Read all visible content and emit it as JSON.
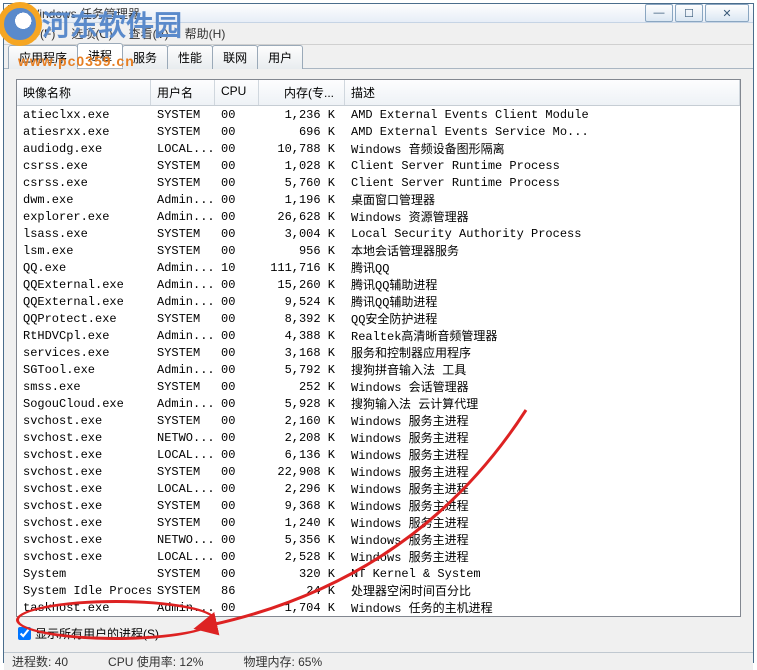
{
  "window": {
    "title": "Windows 任务管理器"
  },
  "watermark": {
    "text": "河东软件园",
    "sub": "www.pc0359.cn"
  },
  "menu": {
    "file": "文件(F)",
    "options": "选项(O)",
    "view": "查看(V)",
    "help": "帮助(H)"
  },
  "tabs": {
    "apps": "应用程序",
    "processes": "进程",
    "services": "服务",
    "performance": "性能",
    "networking": "联网",
    "users": "用户"
  },
  "columns": {
    "image": "映像名称",
    "user": "用户名",
    "cpu": "CPU",
    "mem": "内存(专...",
    "desc": "描述"
  },
  "rows": [
    {
      "img": "atieclxx.exe",
      "user": "SYSTEM",
      "cpu": "00",
      "mem": "1,236 K",
      "desc": "AMD External Events Client Module"
    },
    {
      "img": "atiesrxx.exe",
      "user": "SYSTEM",
      "cpu": "00",
      "mem": "696 K",
      "desc": "AMD External Events Service Mo..."
    },
    {
      "img": "audiodg.exe",
      "user": "LOCAL...",
      "cpu": "00",
      "mem": "10,788 K",
      "desc": "Windows 音频设备图形隔离"
    },
    {
      "img": "csrss.exe",
      "user": "SYSTEM",
      "cpu": "00",
      "mem": "1,028 K",
      "desc": "Client Server Runtime Process"
    },
    {
      "img": "csrss.exe",
      "user": "SYSTEM",
      "cpu": "00",
      "mem": "5,760 K",
      "desc": "Client Server Runtime Process"
    },
    {
      "img": "dwm.exe",
      "user": "Admin...",
      "cpu": "00",
      "mem": "1,196 K",
      "desc": "桌面窗口管理器"
    },
    {
      "img": "explorer.exe",
      "user": "Admin...",
      "cpu": "00",
      "mem": "26,628 K",
      "desc": "Windows 资源管理器"
    },
    {
      "img": "lsass.exe",
      "user": "SYSTEM",
      "cpu": "00",
      "mem": "3,004 K",
      "desc": "Local Security Authority Process"
    },
    {
      "img": "lsm.exe",
      "user": "SYSTEM",
      "cpu": "00",
      "mem": "956 K",
      "desc": "本地会话管理器服务"
    },
    {
      "img": "QQ.exe",
      "user": "Admin...",
      "cpu": "10",
      "mem": "111,716 K",
      "desc": "腾讯QQ"
    },
    {
      "img": "QQExternal.exe",
      "user": "Admin...",
      "cpu": "00",
      "mem": "15,260 K",
      "desc": "腾讯QQ辅助进程"
    },
    {
      "img": "QQExternal.exe",
      "user": "Admin...",
      "cpu": "00",
      "mem": "9,524 K",
      "desc": "腾讯QQ辅助进程"
    },
    {
      "img": "QQProtect.exe",
      "user": "SYSTEM",
      "cpu": "00",
      "mem": "8,392 K",
      "desc": "QQ安全防护进程"
    },
    {
      "img": "RtHDVCpl.exe",
      "user": "Admin...",
      "cpu": "00",
      "mem": "4,388 K",
      "desc": "Realtek高清晰音频管理器"
    },
    {
      "img": "services.exe",
      "user": "SYSTEM",
      "cpu": "00",
      "mem": "3,168 K",
      "desc": "服务和控制器应用程序"
    },
    {
      "img": "SGTool.exe",
      "user": "Admin...",
      "cpu": "00",
      "mem": "5,792 K",
      "desc": "搜狗拼音输入法 工具"
    },
    {
      "img": "smss.exe",
      "user": "SYSTEM",
      "cpu": "00",
      "mem": "252 K",
      "desc": "Windows 会话管理器"
    },
    {
      "img": "SogouCloud.exe",
      "user": "Admin...",
      "cpu": "00",
      "mem": "5,928 K",
      "desc": "搜狗输入法 云计算代理"
    },
    {
      "img": "svchost.exe",
      "user": "SYSTEM",
      "cpu": "00",
      "mem": "2,160 K",
      "desc": "Windows 服务主进程"
    },
    {
      "img": "svchost.exe",
      "user": "NETWO...",
      "cpu": "00",
      "mem": "2,208 K",
      "desc": "Windows 服务主进程"
    },
    {
      "img": "svchost.exe",
      "user": "LOCAL...",
      "cpu": "00",
      "mem": "6,136 K",
      "desc": "Windows 服务主进程"
    },
    {
      "img": "svchost.exe",
      "user": "SYSTEM",
      "cpu": "00",
      "mem": "22,908 K",
      "desc": "Windows 服务主进程"
    },
    {
      "img": "svchost.exe",
      "user": "LOCAL...",
      "cpu": "00",
      "mem": "2,296 K",
      "desc": "Windows 服务主进程"
    },
    {
      "img": "svchost.exe",
      "user": "SYSTEM",
      "cpu": "00",
      "mem": "9,368 K",
      "desc": "Windows 服务主进程"
    },
    {
      "img": "svchost.exe",
      "user": "SYSTEM",
      "cpu": "00",
      "mem": "1,240 K",
      "desc": "Windows 服务主进程"
    },
    {
      "img": "svchost.exe",
      "user": "NETWO...",
      "cpu": "00",
      "mem": "5,356 K",
      "desc": "Windows 服务主进程"
    },
    {
      "img": "svchost.exe",
      "user": "LOCAL...",
      "cpu": "00",
      "mem": "2,528 K",
      "desc": "Windows 服务主进程"
    },
    {
      "img": "System",
      "user": "SYSTEM",
      "cpu": "00",
      "mem": "320 K",
      "desc": "NT Kernel & System"
    },
    {
      "img": "System Idle Process",
      "user": "SYSTEM",
      "cpu": "86",
      "mem": "24 K",
      "desc": "处理器空闲时间百分比"
    },
    {
      "img": "taskhost.exe",
      "user": "Admin...",
      "cpu": "00",
      "mem": "1,704 K",
      "desc": "Windows 任务的主机进程"
    }
  ],
  "show_all": {
    "label": "显示所有用户的进程(S)",
    "checked": true
  },
  "status": {
    "procs_label": "进程数:",
    "procs_value": "40",
    "cpu_label": "CPU 使用率:",
    "cpu_value": "12%",
    "mem_label": "物理内存:",
    "mem_value": "65%"
  },
  "annotation": {
    "circle_color": "#d22",
    "arrow_color": "#d22"
  }
}
